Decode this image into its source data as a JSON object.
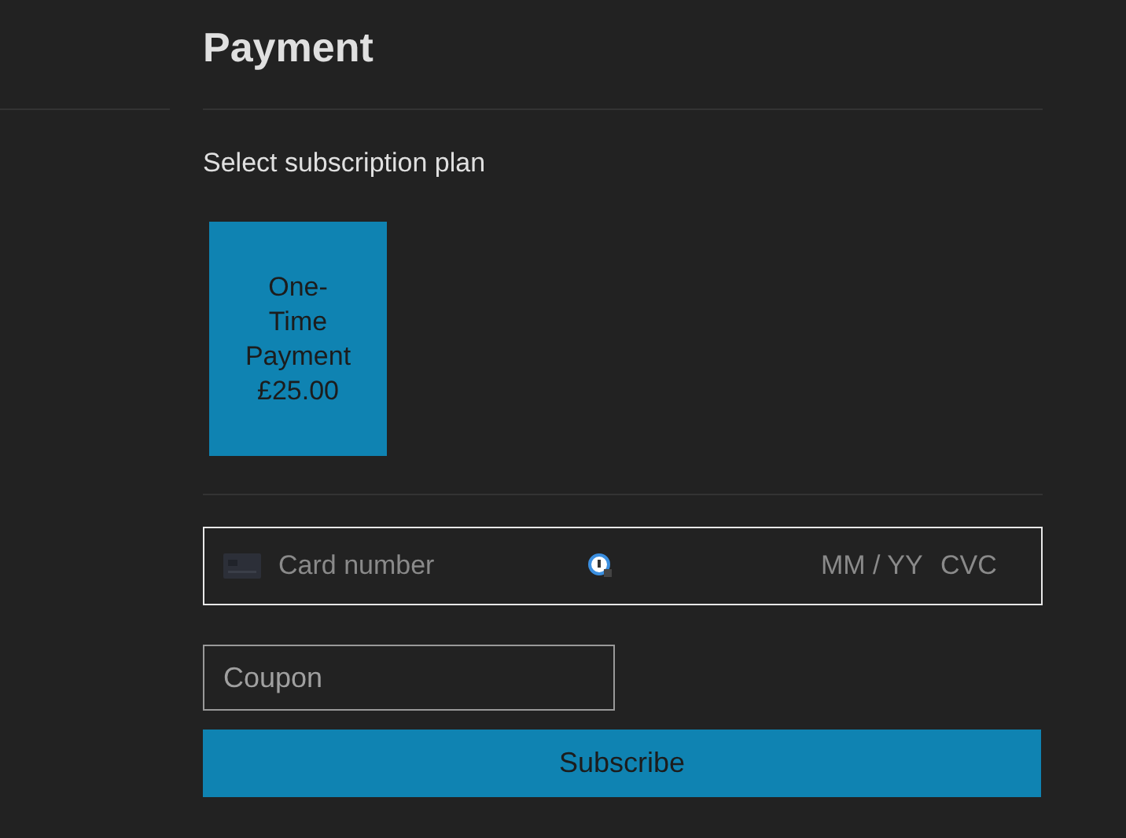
{
  "title": "Payment",
  "plan_heading": "Select subscription plan",
  "plans": [
    {
      "name": "One-Time Payment",
      "price": "£25.00",
      "selected": true
    }
  ],
  "card_field": {
    "number_placeholder": "Card number",
    "expiry_placeholder": "MM / YY",
    "cvc_placeholder": "CVC"
  },
  "coupon": {
    "placeholder": "Coupon"
  },
  "submit": "Subscribe"
}
